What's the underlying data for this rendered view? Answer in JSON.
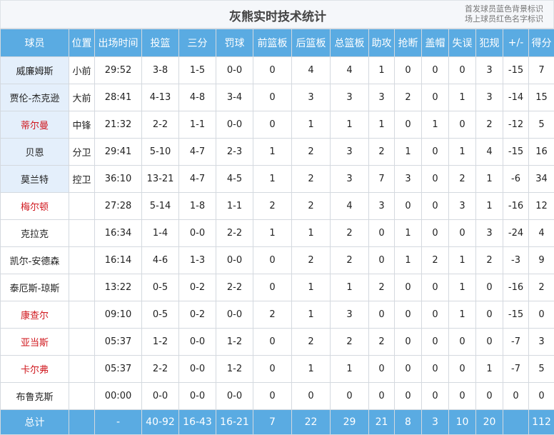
{
  "title": "灰熊实时技术统计",
  "notes": [
    "首发球员蓝色背景标识",
    "场上球员红色名字标识"
  ],
  "columns": [
    "球员",
    "位置",
    "出场时间",
    "投篮",
    "三分",
    "罚球",
    "前篮板",
    "后篮板",
    "总篮板",
    "助攻",
    "抢断",
    "盖帽",
    "失误",
    "犯规",
    "+/-",
    "得分"
  ],
  "players": [
    {
      "cells": [
        "威廉姆斯",
        "小前",
        "29:52",
        "3-8",
        "1-5",
        "0-0",
        "0",
        "4",
        "4",
        "1",
        "0",
        "0",
        "0",
        "3",
        "-15",
        "7"
      ],
      "starter": true,
      "oncourt": false
    },
    {
      "cells": [
        "贾伦-杰克逊",
        "大前",
        "28:41",
        "4-13",
        "4-8",
        "3-4",
        "0",
        "3",
        "3",
        "3",
        "2",
        "0",
        "1",
        "3",
        "-14",
        "15"
      ],
      "starter": true,
      "oncourt": false
    },
    {
      "cells": [
        "蒂尔曼",
        "中锋",
        "21:32",
        "2-2",
        "1-1",
        "0-0",
        "0",
        "1",
        "1",
        "1",
        "0",
        "1",
        "0",
        "2",
        "-12",
        "5"
      ],
      "starter": true,
      "oncourt": true
    },
    {
      "cells": [
        "贝恩",
        "分卫",
        "29:41",
        "5-10",
        "4-7",
        "2-3",
        "1",
        "2",
        "3",
        "2",
        "1",
        "0",
        "1",
        "4",
        "-15",
        "16"
      ],
      "starter": true,
      "oncourt": false
    },
    {
      "cells": [
        "莫兰特",
        "控卫",
        "36:10",
        "13-21",
        "4-7",
        "4-5",
        "1",
        "2",
        "3",
        "7",
        "3",
        "0",
        "2",
        "1",
        "-6",
        "34"
      ],
      "starter": true,
      "oncourt": false
    },
    {
      "cells": [
        "梅尔顿",
        "",
        "27:28",
        "5-14",
        "1-8",
        "1-1",
        "2",
        "2",
        "4",
        "3",
        "0",
        "0",
        "3",
        "1",
        "-16",
        "12"
      ],
      "starter": false,
      "oncourt": true
    },
    {
      "cells": [
        "克拉克",
        "",
        "16:34",
        "1-4",
        "0-0",
        "2-2",
        "1",
        "1",
        "2",
        "0",
        "1",
        "0",
        "0",
        "3",
        "-24",
        "4"
      ],
      "starter": false,
      "oncourt": false
    },
    {
      "cells": [
        "凯尔-安德森",
        "",
        "16:14",
        "4-6",
        "1-3",
        "0-0",
        "0",
        "2",
        "2",
        "0",
        "1",
        "2",
        "1",
        "2",
        "-3",
        "9"
      ],
      "starter": false,
      "oncourt": false
    },
    {
      "cells": [
        "泰厄斯-琼斯",
        "",
        "13:22",
        "0-5",
        "0-2",
        "2-2",
        "0",
        "1",
        "1",
        "2",
        "0",
        "0",
        "1",
        "0",
        "-16",
        "2"
      ],
      "starter": false,
      "oncourt": false
    },
    {
      "cells": [
        "康查尔",
        "",
        "09:10",
        "0-5",
        "0-2",
        "0-0",
        "2",
        "1",
        "3",
        "0",
        "0",
        "0",
        "1",
        "0",
        "-15",
        "0"
      ],
      "starter": false,
      "oncourt": true
    },
    {
      "cells": [
        "亚当斯",
        "",
        "05:37",
        "1-2",
        "0-0",
        "1-2",
        "0",
        "2",
        "2",
        "2",
        "0",
        "0",
        "0",
        "0",
        "-7",
        "3"
      ],
      "starter": false,
      "oncourt": true
    },
    {
      "cells": [
        "卡尔弗",
        "",
        "05:37",
        "2-2",
        "0-0",
        "1-2",
        "0",
        "1",
        "1",
        "0",
        "0",
        "0",
        "0",
        "1",
        "-7",
        "5"
      ],
      "starter": false,
      "oncourt": true
    },
    {
      "cells": [
        "布鲁克斯",
        "",
        "00:00",
        "0-0",
        "0-0",
        "0-0",
        "0",
        "0",
        "0",
        "0",
        "0",
        "0",
        "0",
        "0",
        "0",
        "0"
      ],
      "starter": false,
      "oncourt": false
    }
  ],
  "totals": [
    "总计",
    "",
    "-",
    "40-92",
    "16-43",
    "16-21",
    "7",
    "22",
    "29",
    "21",
    "8",
    "3",
    "10",
    "20",
    "",
    "112"
  ],
  "colors": {
    "header": "#5aabe2",
    "starter_bg": "#e4effb",
    "oncourt_text": "#d0191f"
  }
}
